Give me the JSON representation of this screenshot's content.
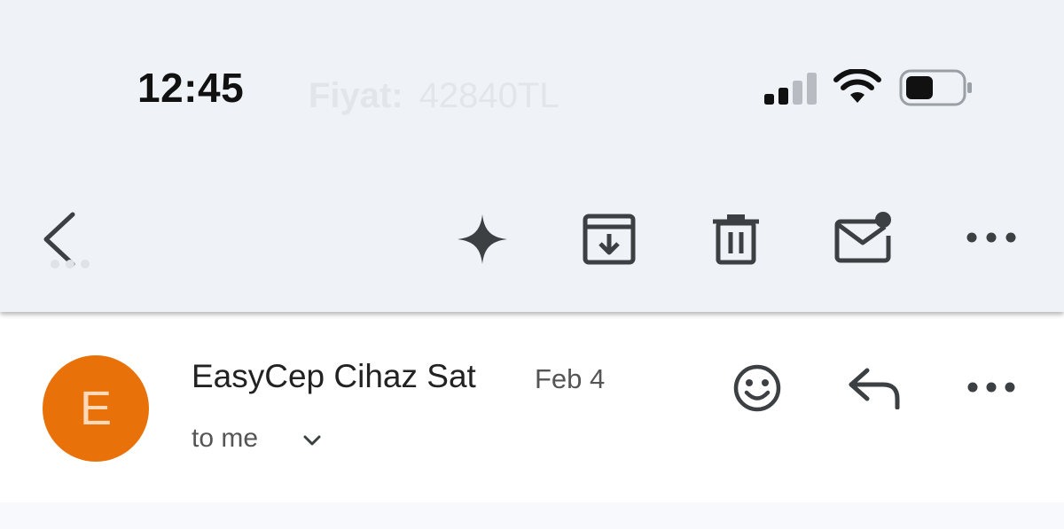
{
  "status_bar": {
    "time": "12:45",
    "ghost_label": "Fiyat:",
    "ghost_value": "42840TL",
    "icons": [
      "cellular-signal-icon",
      "wifi-icon",
      "battery-icon"
    ]
  },
  "toolbar": {
    "icons": [
      "back-arrow-icon",
      "sparkle-icon",
      "archive-icon",
      "trash-icon",
      "mark-unread-icon",
      "more-options-icon"
    ]
  },
  "email": {
    "avatar_letter": "E",
    "sender": "EasyCep Cihaz Sat",
    "date": "Feb 4",
    "recipient": "to me",
    "icons": [
      "emoji-reaction-icon",
      "reply-icon",
      "more-options-icon"
    ]
  },
  "colors": {
    "toolbar_bg": "#eff2f7",
    "avatar_bg": "#e8710a",
    "avatar_text": "#ffd9b8",
    "icon": "#3c4043"
  }
}
